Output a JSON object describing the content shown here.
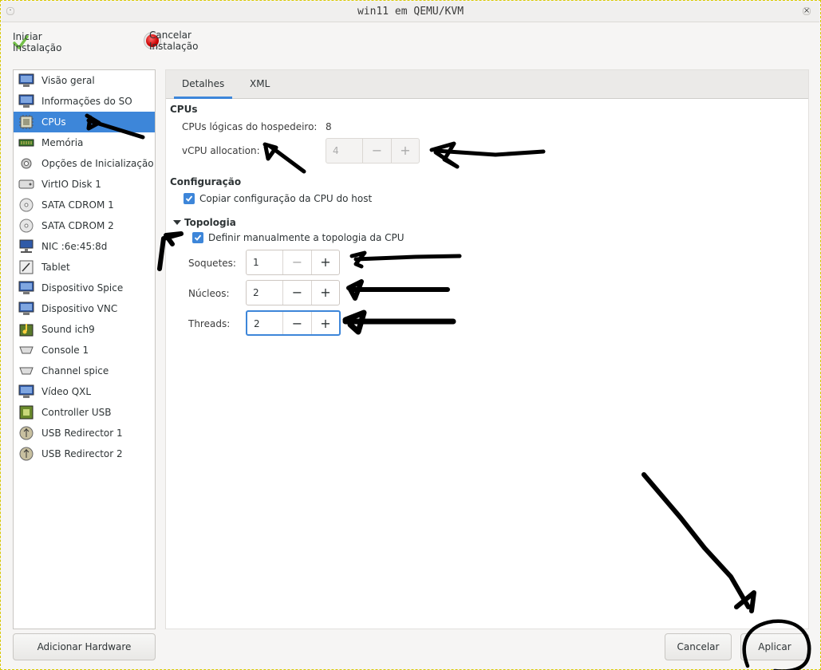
{
  "window": {
    "title": "win11 em QEMU/KVM",
    "close_glyph": "×",
    "menu_glyph": "·"
  },
  "toolbar": {
    "begin_install": {
      "label": "Iniciar Instalação",
      "icon": "check-icon"
    },
    "cancel_install": {
      "label": "Cancelar Instalação",
      "icon": "stop-icon"
    }
  },
  "sidebar": {
    "items": [
      {
        "label": "Visão geral",
        "icon": "monitor-icon"
      },
      {
        "label": "Informações do SO",
        "icon": "monitor-icon"
      },
      {
        "label": "CPUs",
        "icon": "cpu-icon",
        "selected": true
      },
      {
        "label": "Memória",
        "icon": "memory-icon"
      },
      {
        "label": "Opções de Inicialização",
        "icon": "gear-icon"
      },
      {
        "label": "VirtIO Disk 1",
        "icon": "disk-icon"
      },
      {
        "label": "SATA CDROM 1",
        "icon": "cdrom-icon"
      },
      {
        "label": "SATA CDROM 2",
        "icon": "cdrom-icon"
      },
      {
        "label": "NIC :6e:45:8d",
        "icon": "network-icon"
      },
      {
        "label": "Tablet",
        "icon": "tablet-icon"
      },
      {
        "label": "Dispositivo Spice",
        "icon": "monitor-icon"
      },
      {
        "label": "Dispositivo VNC",
        "icon": "monitor-icon"
      },
      {
        "label": "Sound ich9",
        "icon": "sound-icon"
      },
      {
        "label": "Console 1",
        "icon": "serial-icon"
      },
      {
        "label": "Channel spice",
        "icon": "serial-icon"
      },
      {
        "label": "Vídeo QXL",
        "icon": "monitor-icon"
      },
      {
        "label": "Controller USB",
        "icon": "controller-icon"
      },
      {
        "label": "USB Redirector 1",
        "icon": "usb-icon"
      },
      {
        "label": "USB Redirector 2",
        "icon": "usb-icon"
      }
    ],
    "add_hardware_label": "Adicionar Hardware"
  },
  "tabs": [
    {
      "label": "Detalhes",
      "active": true
    },
    {
      "label": "XML",
      "active": false
    }
  ],
  "cpus": {
    "section_title": "CPUs",
    "host_logical_label": "CPUs lógicas do hospedeiro:",
    "host_logical_value": "8",
    "vcpu_label": "vCPU allocation:",
    "vcpu_value": "4"
  },
  "config": {
    "section_title": "Configuração",
    "copy_host_label": "Copiar configuração da CPU do host",
    "copy_host_checked": true
  },
  "topology": {
    "section_title": "Topologia",
    "manual_label": "Definir manualmente a topologia da CPU",
    "manual_checked": true,
    "sockets_label": "Soquetes:",
    "sockets_value": "1",
    "cores_label": "Núcleos:",
    "cores_value": "2",
    "threads_label": "Threads:",
    "threads_value": "2"
  },
  "spin_glyphs": {
    "minus": "−",
    "plus": "+"
  },
  "footer": {
    "cancel_label": "Cancelar",
    "apply_label": "Aplicar"
  },
  "colors": {
    "accent": "#3d86d9",
    "annotation_ink": "#000000"
  }
}
